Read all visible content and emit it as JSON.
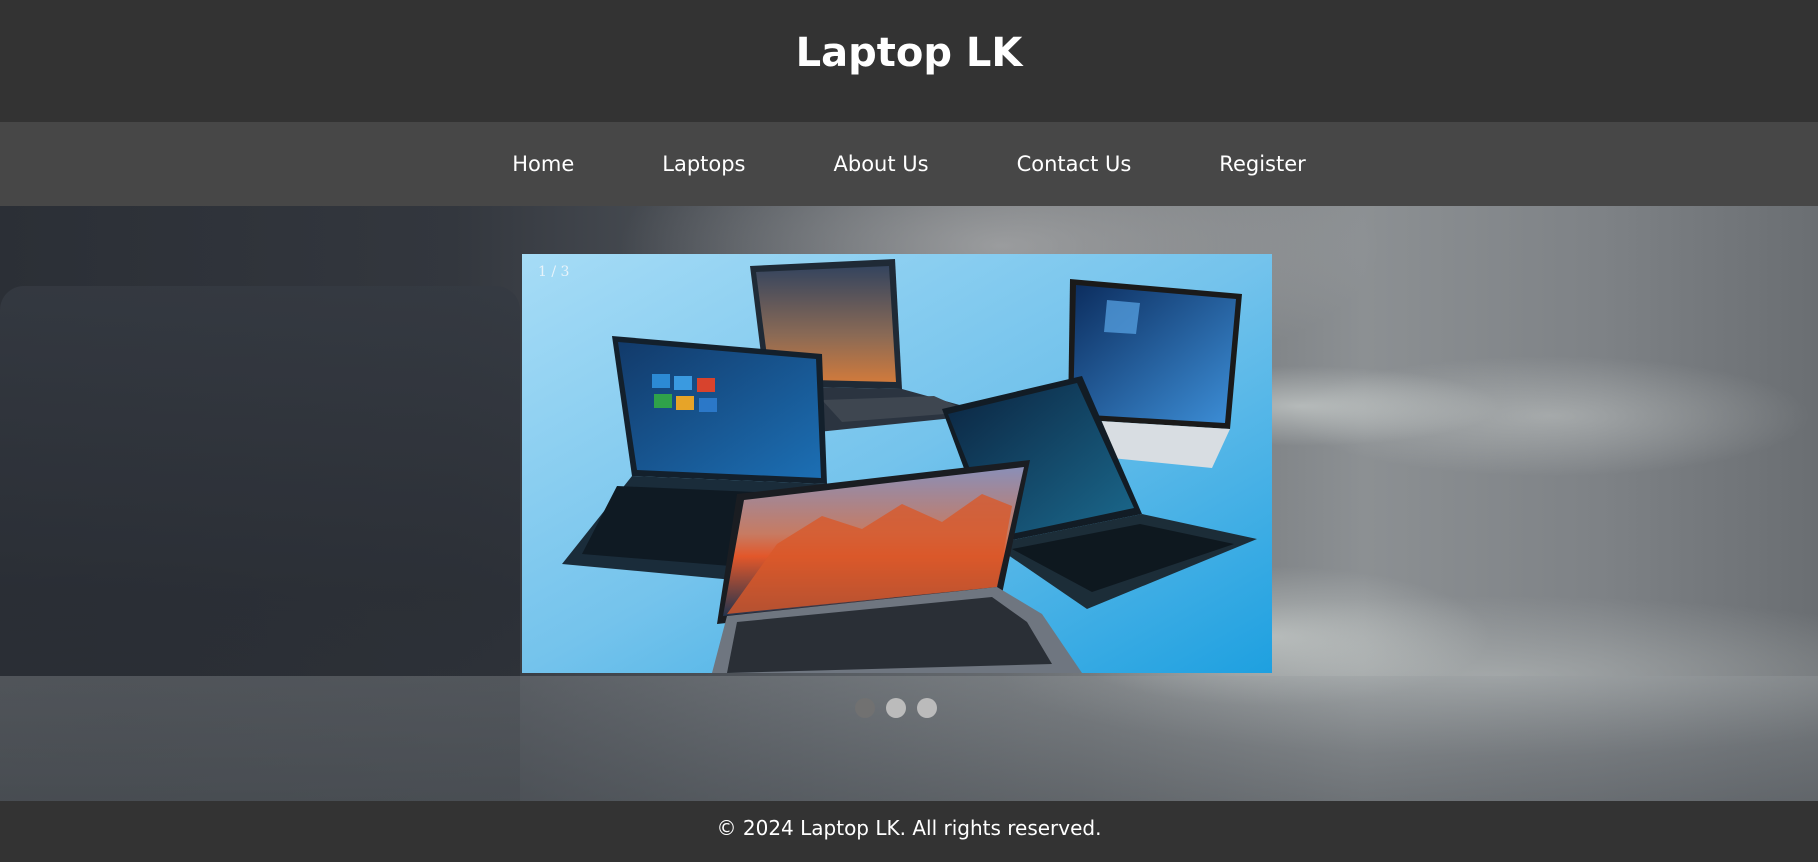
{
  "header": {
    "title": "Laptop LK"
  },
  "nav": {
    "items": [
      {
        "label": "Home"
      },
      {
        "label": "Laptops"
      },
      {
        "label": "About Us"
      },
      {
        "label": "Contact Us"
      },
      {
        "label": "Register"
      }
    ]
  },
  "slideshow": {
    "counter": "1 / 3",
    "current": 1,
    "total": 3,
    "image_icon": "laptops-photo"
  },
  "footer": {
    "text": "© 2024 Laptop LK. All rights reserved."
  },
  "colors": {
    "header_bg": "#333333",
    "nav_bg": "#474747",
    "dot_active": "#717171",
    "dot_inactive": "#bbbbbb"
  }
}
